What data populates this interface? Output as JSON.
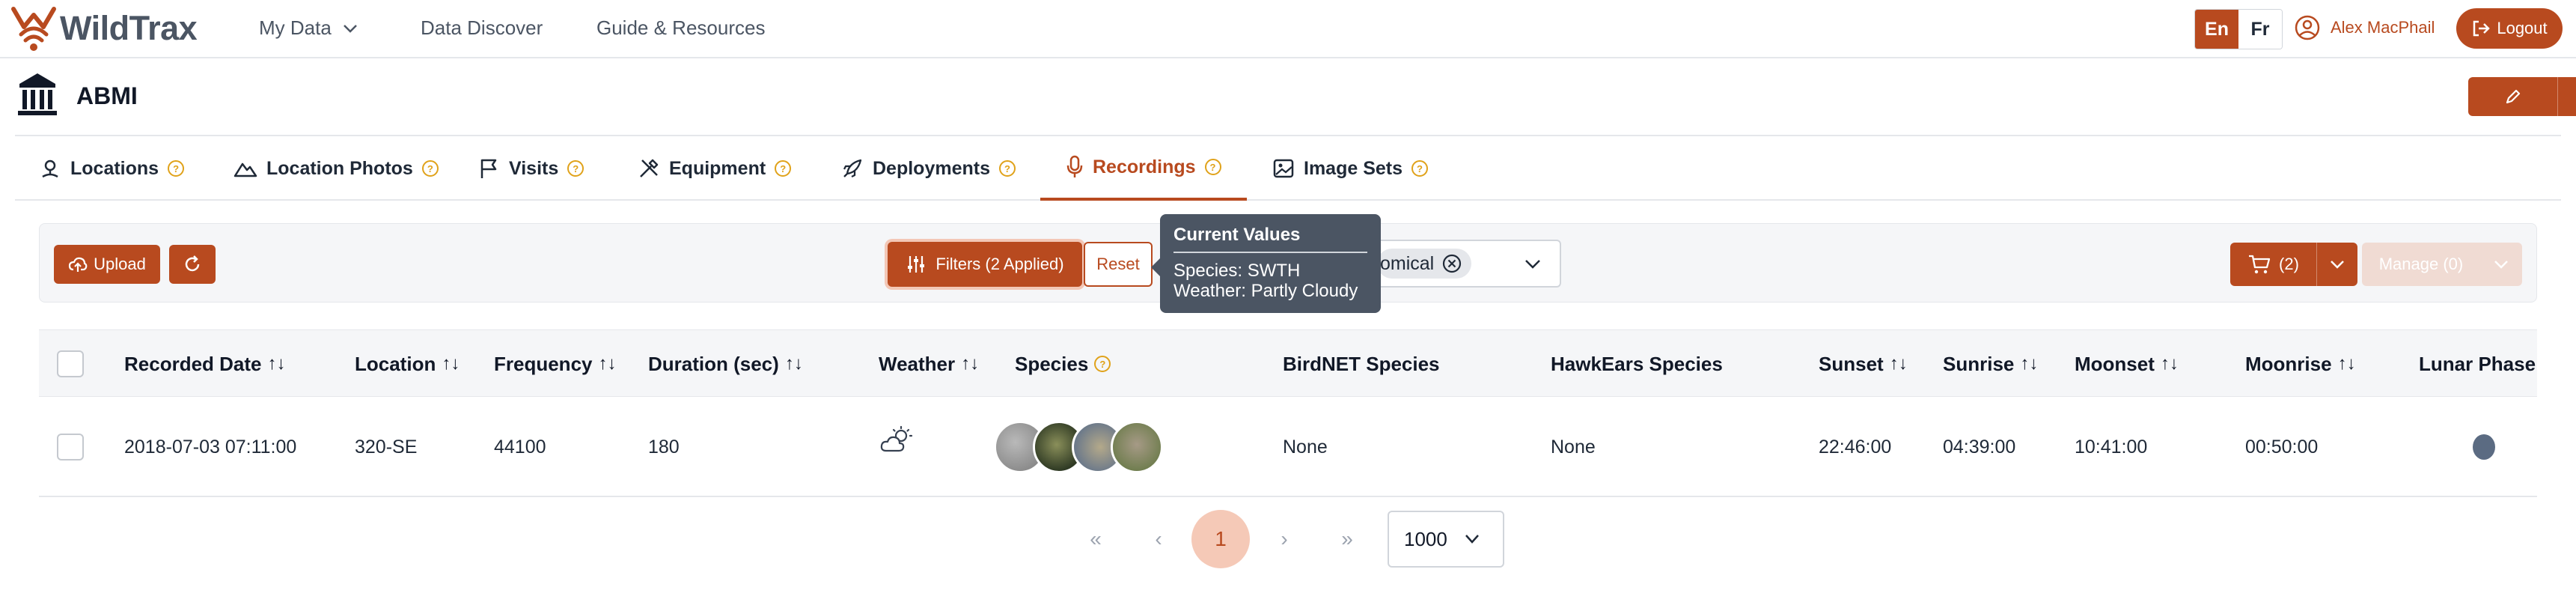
{
  "app": {
    "logo_text": "WildTrax",
    "nav": [
      "My Data",
      "Data Discover",
      "Guide & Resources"
    ],
    "lang": [
      "En",
      "Fr"
    ],
    "user": "Alex MacPhail",
    "logout": "Logout",
    "brand_color": "#b84a1f"
  },
  "project": {
    "title": "ABMI"
  },
  "tabs": [
    {
      "label": "Locations",
      "icon": "location-pin-icon"
    },
    {
      "label": "Location Photos",
      "icon": "landscape-icon"
    },
    {
      "label": "Visits",
      "icon": "flag-icon"
    },
    {
      "label": "Equipment",
      "icon": "tools-icon"
    },
    {
      "label": "Deployments",
      "icon": "rocket-icon"
    },
    {
      "label": "Recordings",
      "icon": "microphone-icon",
      "active": true
    },
    {
      "label": "Image Sets",
      "icon": "image-icon"
    }
  ],
  "toolbar": {
    "upload": "Upload",
    "filters": "Filters (2 Applied)",
    "reset": "Reset",
    "chip_text": "omical",
    "cart": "(2)",
    "manage": "Manage (0)"
  },
  "tooltip": {
    "title": "Current Values",
    "lines": [
      "Species: SWTH",
      "Weather: Partly Cloudy"
    ]
  },
  "table": {
    "headers": [
      "Recorded Date",
      "Location",
      "Frequency",
      "Duration (sec)",
      "Weather",
      "Species",
      "BirdNET Species",
      "HawkEars Species",
      "Sunset",
      "Sunrise",
      "Moonset",
      "Moonrise",
      "Lunar Phase"
    ],
    "rows": [
      {
        "recorded_date": "2018-07-03 07:11:00",
        "location": "320-SE",
        "frequency": "44100",
        "duration": "180",
        "weather_icon": "partly-cloudy-icon",
        "birdnet": "None",
        "hawkears": "None",
        "sunset": "22:46:00",
        "sunrise": "04:39:00",
        "moonset": "10:41:00",
        "moonrise": "00:50:00"
      }
    ]
  },
  "pagination": {
    "first": "«",
    "prev": "‹",
    "page": "1",
    "next": "›",
    "last": "»",
    "per_page": "1000"
  }
}
